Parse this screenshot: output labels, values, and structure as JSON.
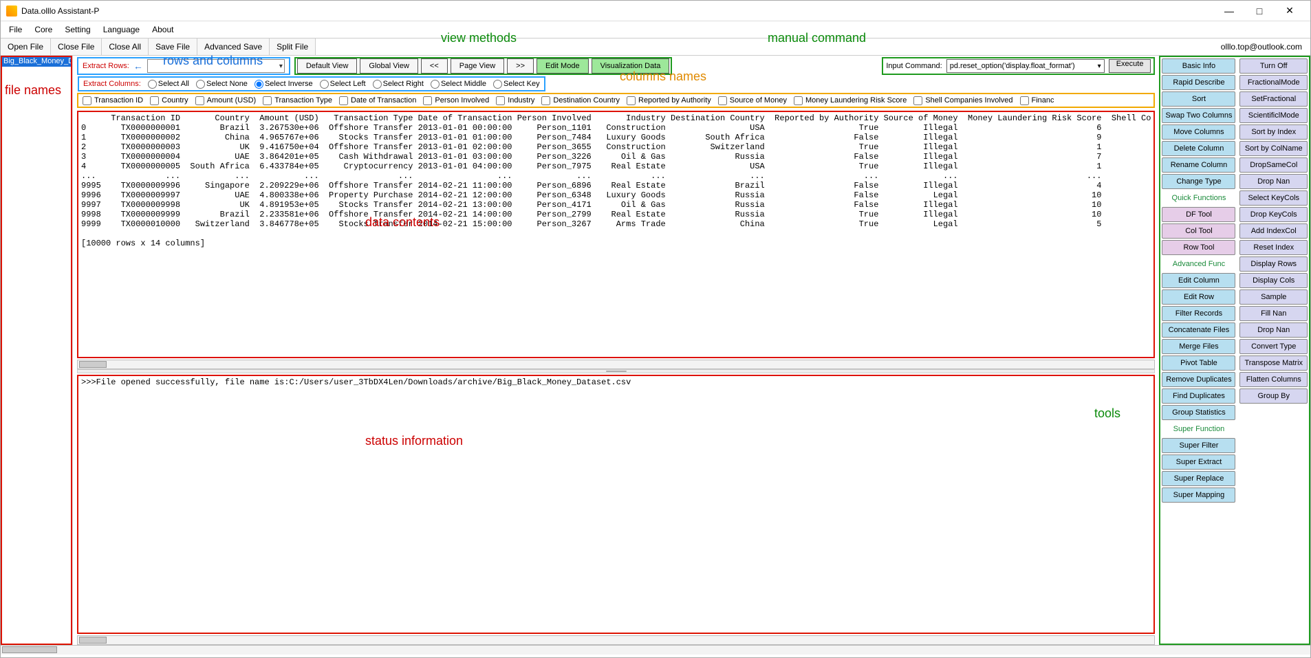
{
  "window": {
    "title": "Data.olllo Assistant-P"
  },
  "win_buttons": {
    "min": "—",
    "max": "□",
    "close": "✕"
  },
  "menubar": [
    "File",
    "Core",
    "Setting",
    "Language",
    "About"
  ],
  "toolbar1": [
    "Open File",
    "Close File",
    "Close All",
    "Save File",
    "Advanced Save",
    "Split File"
  ],
  "user_email": "olllo.top@outlook.com",
  "files": [
    "Big_Black_Money_Dat"
  ],
  "extract_rows_label": "Extract Rows:",
  "extract_cols_label": "Extract Columns:",
  "col_select_modes": [
    "Select All",
    "Select None",
    "Select Inverse",
    "Select Left",
    "Select Right",
    "Select Middle",
    "Select Key"
  ],
  "col_select_checked_index": 2,
  "view_buttons": [
    "Default View",
    "Global View",
    "<<",
    "Page View",
    ">>",
    "Edit Mode",
    "Visualization Data"
  ],
  "view_green_indices": [
    5,
    6
  ],
  "cmd": {
    "label": "Input Command:",
    "value": "pd.reset_option('display.float_format')",
    "exec": "Execute"
  },
  "columns": [
    "Transaction ID",
    "Country",
    "Amount (USD)",
    "Transaction Type",
    "Date of Transaction",
    "Person Involved",
    "Industry",
    "Destination Country",
    "Reported by Authority",
    "Source of Money",
    "Money Laundering Risk Score",
    "Shell Companies Involved",
    "Financ"
  ],
  "data_header": "      Transaction ID       Country  Amount (USD)   Transaction Type Date of Transaction Person Involved       Industry Destination Country  Reported by Authority Source of Money  Money Laundering Risk Score  Shell Co",
  "data_rows": [
    "0       TX0000000001        Brazil  3.267530e+06  Offshore Transfer 2013-01-01 00:00:00     Person_1101   Construction                 USA                   True         Illegal                            6",
    "1       TX0000000002         China  4.965767e+06    Stocks Transfer 2013-01-01 01:00:00     Person_7484   Luxury Goods        South Africa                  False         Illegal                            9",
    "2       TX0000000003            UK  9.416750e+04  Offshore Transfer 2013-01-01 02:00:00     Person_3655   Construction         Switzerland                   True         Illegal                            1",
    "3       TX0000000004           UAE  3.864201e+05    Cash Withdrawal 2013-01-01 03:00:00     Person_3226      Oil & Gas              Russia                  False         Illegal                            7",
    "4       TX0000000005  South Africa  6.433784e+05     Cryptocurrency 2013-01-01 04:00:00     Person_7975    Real Estate                 USA                   True         Illegal                            1",
    "...              ...           ...           ...                ...                 ...             ...            ...                 ...                    ...             ...                          ...",
    "9995    TX0000009996     Singapore  2.209229e+06  Offshore Transfer 2014-02-21 11:00:00     Person_6896    Real Estate              Brazil                  False         Illegal                            4",
    "9996    TX0000009997           UAE  4.800338e+06  Property Purchase 2014-02-21 12:00:00     Person_6348   Luxury Goods              Russia                  False           Legal                           10",
    "9997    TX0000009998            UK  4.891953e+05    Stocks Transfer 2014-02-21 13:00:00     Person_4171      Oil & Gas              Russia                  False         Illegal                           10",
    "9998    TX0000009999        Brazil  2.233581e+06  Offshore Transfer 2014-02-21 14:00:00     Person_2799    Real Estate              Russia                   True         Illegal                           10",
    "9999    TX0000010000   Switzerland  3.846778e+05    Stocks Transfer 2014-02-21 15:00:00     Person_3267     Arms Trade               China                   True           Legal                            5"
  ],
  "data_footer": "[10000 rows x 14 columns]",
  "status_text": ">>>File opened successfully, file name is:C:/Users/user_3TbDX4Len/Downloads/archive/Big_Black_Money_Dataset.csv",
  "tools": {
    "left": [
      {
        "t": "Basic Info",
        "c": "blue"
      },
      {
        "t": "Rapid Describe",
        "c": "blue"
      },
      {
        "t": "Sort",
        "c": "blue"
      },
      {
        "t": "Swap Two Columns",
        "c": "blue"
      },
      {
        "t": "Move Columns",
        "c": "blue"
      },
      {
        "t": "Delete Column",
        "c": "blue"
      },
      {
        "t": "Rename Column",
        "c": "blue"
      },
      {
        "t": "Change Type",
        "c": "blue"
      },
      {
        "t": "Quick Functions",
        "c": "header"
      },
      {
        "t": "DF Tool",
        "c": "pink"
      },
      {
        "t": "Col Tool",
        "c": "pink"
      },
      {
        "t": "Row Tool",
        "c": "pink"
      },
      {
        "t": "Advanced Func",
        "c": "header"
      },
      {
        "t": "Edit Column",
        "c": "blue"
      },
      {
        "t": "Edit Row",
        "c": "blue"
      },
      {
        "t": "Filter Records",
        "c": "blue"
      },
      {
        "t": "Concatenate Files",
        "c": "blue"
      },
      {
        "t": "Merge Files",
        "c": "blue"
      },
      {
        "t": "Pivot Table",
        "c": "blue"
      },
      {
        "t": "Remove Duplicates",
        "c": "blue"
      },
      {
        "t": "Find Duplicates",
        "c": "blue"
      },
      {
        "t": "Group Statistics",
        "c": "blue"
      },
      {
        "t": "Super Function",
        "c": "header"
      },
      {
        "t": "Super Filter",
        "c": "blue"
      },
      {
        "t": "Super Extract",
        "c": "blue"
      },
      {
        "t": "Super Replace",
        "c": "blue"
      },
      {
        "t": "Super Mapping",
        "c": "blue"
      }
    ],
    "right": [
      {
        "t": "Turn Off",
        "c": "lav"
      },
      {
        "t": "FractionalMode",
        "c": "lav"
      },
      {
        "t": "SetFractional",
        "c": "lav"
      },
      {
        "t": "ScientificlMode",
        "c": "lav"
      },
      {
        "t": "Sort by Index",
        "c": "lav"
      },
      {
        "t": "Sort by ColName",
        "c": "lav"
      },
      {
        "t": "DropSameCol",
        "c": "lav"
      },
      {
        "t": "Drop Nan",
        "c": "lav"
      },
      {
        "t": "Select KeyCols",
        "c": "lav"
      },
      {
        "t": "Drop KeyCols",
        "c": "lav"
      },
      {
        "t": "Add IndexCol",
        "c": "lav"
      },
      {
        "t": "Reset Index",
        "c": "lav"
      },
      {
        "t": "Display Rows",
        "c": "lav"
      },
      {
        "t": "Display Cols",
        "c": "lav"
      },
      {
        "t": "Sample",
        "c": "lav"
      },
      {
        "t": "Fill Nan",
        "c": "lav"
      },
      {
        "t": "Drop Nan",
        "c": "lav"
      },
      {
        "t": "Convert Type",
        "c": "lav"
      },
      {
        "t": "Transpose Matrix",
        "c": "lav"
      },
      {
        "t": "Flatten Columns",
        "c": "lav"
      },
      {
        "t": "Group By",
        "c": "lav"
      }
    ]
  },
  "annotations": {
    "view_methods": "view methods",
    "manual_command": "manual command",
    "rows_and_columns": "rows and columns",
    "file_names": "file names",
    "columns_names": "columns names",
    "data_contents": "data contents",
    "status_information": "status information",
    "tools": "tools"
  }
}
